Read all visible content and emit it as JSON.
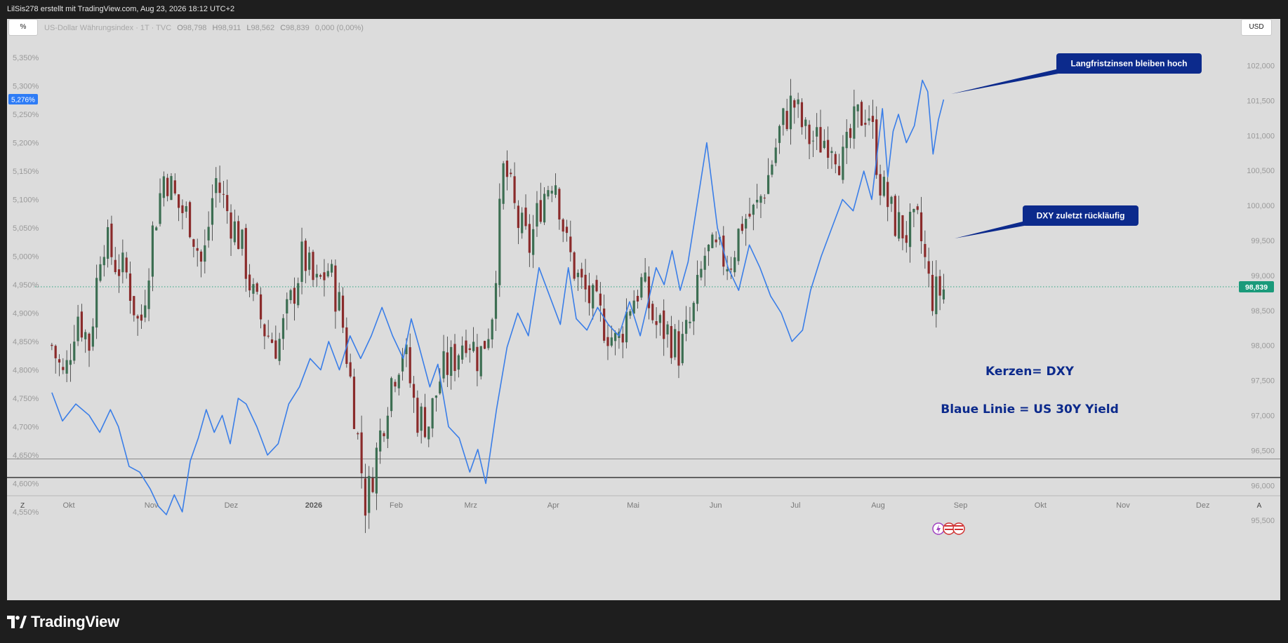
{
  "header": {
    "text": "LilSis278 erstellt mit TradingView.com, Aug 23, 2026 18:12 UTC+2"
  },
  "toolbar": {
    "scale_left": "%",
    "currency": "USD",
    "zoom_label": "Z",
    "auto_label": "A"
  },
  "legend": {
    "name": "US-Dollar Währungsindex · 1T · TVC",
    "open_prefix": "O",
    "open": "98,798",
    "high_prefix": "H",
    "high": "98,911",
    "low_prefix": "L",
    "low": "98,562",
    "close_prefix": "C",
    "close": "98,839",
    "change": "0,000 (0,00%)"
  },
  "price_badges": {
    "yield_last": "5,276%",
    "dxy_last": "98,839"
  },
  "annotations": {
    "top_label": "Langfristzinsen bleiben hoch",
    "mid_label": "DXY zuletzt rückläufig",
    "legend_line1": "Kerzen= DXY",
    "legend_line2": "Blaue Linie = US 30Y Yield"
  },
  "brand": {
    "name": "TradingView"
  },
  "colors": {
    "up": "#3c6e52",
    "down": "#8a2b2b",
    "yield_line": "#3a7ee8",
    "annotation_bg": "#0c2a8c",
    "annotation_text": "#0c2a8c",
    "badge_yield": "#2e7cf6",
    "badge_dxy": "#1a9a7a"
  },
  "chart_data": {
    "type": "line",
    "x_axis": {
      "labels": [
        "Okt",
        "Nov",
        "Dez",
        "2026",
        "Feb",
        "Mrz",
        "Apr",
        "Mai",
        "Jun",
        "Jul",
        "Aug",
        "Sep",
        "Okt",
        "Nov",
        "Dez"
      ]
    },
    "y_axis_left": {
      "labels": [
        "5,350%",
        "5,300%",
        "5,250%",
        "5,200%",
        "5,150%",
        "5,100%",
        "5,050%",
        "5,000%",
        "4,950%",
        "4,900%",
        "4,850%",
        "4,800%",
        "4,750%",
        "4,700%",
        "4,650%",
        "4,600%",
        "4,550%"
      ],
      "range": [
        4.5,
        5.38
      ]
    },
    "y_axis_right": {
      "labels": [
        "102,000",
        "101,500",
        "101,000",
        "100,500",
        "100,000",
        "99,500",
        "99,000",
        "98,500",
        "98,000",
        "97,500",
        "97,000",
        "96,500",
        "96,000",
        "95,500"
      ],
      "range": [
        95.0,
        102.4
      ]
    },
    "series": [
      {
        "axis": "left",
        "last": 5.276,
        "points": [
          [
            "2025-09-22",
            4.76
          ],
          [
            "2025-09-26",
            4.71
          ],
          [
            "2025-10-01",
            4.74
          ],
          [
            "2025-10-06",
            4.72
          ],
          [
            "2025-10-10",
            4.69
          ],
          [
            "2025-10-14",
            4.73
          ],
          [
            "2025-10-17",
            4.7
          ],
          [
            "2025-10-21",
            4.63
          ],
          [
            "2025-10-25",
            4.62
          ],
          [
            "2025-10-29",
            4.59
          ],
          [
            "2025-11-01",
            4.56
          ],
          [
            "2025-11-04",
            4.545
          ],
          [
            "2025-11-07",
            4.58
          ],
          [
            "2025-11-10",
            4.55
          ],
          [
            "2025-11-13",
            4.64
          ],
          [
            "2025-11-16",
            4.68
          ],
          [
            "2025-11-19",
            4.73
          ],
          [
            "2025-11-22",
            4.69
          ],
          [
            "2025-11-25",
            4.72
          ],
          [
            "2025-11-28",
            4.67
          ],
          [
            "2025-12-01",
            4.75
          ],
          [
            "2025-12-04",
            4.74
          ],
          [
            "2025-12-08",
            4.7
          ],
          [
            "2025-12-12",
            4.65
          ],
          [
            "2025-12-16",
            4.67
          ],
          [
            "2025-12-20",
            4.74
          ],
          [
            "2025-12-24",
            4.77
          ],
          [
            "2025-12-28",
            4.82
          ],
          [
            "2026-01-01",
            4.8
          ],
          [
            "2026-01-04",
            4.85
          ],
          [
            "2026-01-08",
            4.8
          ],
          [
            "2026-01-12",
            4.86
          ],
          [
            "2026-01-16",
            4.82
          ],
          [
            "2026-01-20",
            4.86
          ],
          [
            "2026-01-24",
            4.91
          ],
          [
            "2026-01-28",
            4.86
          ],
          [
            "2026-02-01",
            4.82
          ],
          [
            "2026-02-04",
            4.89
          ],
          [
            "2026-02-07",
            4.84
          ],
          [
            "2026-02-11",
            4.77
          ],
          [
            "2026-02-14",
            4.81
          ],
          [
            "2026-02-18",
            4.7
          ],
          [
            "2026-02-22",
            4.68
          ],
          [
            "2026-02-26",
            4.62
          ],
          [
            "2026-03-01",
            4.66
          ],
          [
            "2026-03-04",
            4.6
          ],
          [
            "2026-03-08",
            4.73
          ],
          [
            "2026-03-12",
            4.84
          ],
          [
            "2026-03-16",
            4.9
          ],
          [
            "2026-03-20",
            4.86
          ],
          [
            "2026-03-24",
            4.98
          ],
          [
            "2026-03-28",
            4.93
          ],
          [
            "2026-04-01",
            4.88
          ],
          [
            "2026-04-04",
            4.98
          ],
          [
            "2026-04-07",
            4.89
          ],
          [
            "2026-04-11",
            4.87
          ],
          [
            "2026-04-15",
            4.91
          ],
          [
            "2026-04-19",
            4.88
          ],
          [
            "2026-04-23",
            4.86
          ],
          [
            "2026-04-27",
            4.92
          ],
          [
            "2026-05-01",
            4.86
          ],
          [
            "2026-05-04",
            4.92
          ],
          [
            "2026-05-07",
            4.98
          ],
          [
            "2026-05-10",
            4.95
          ],
          [
            "2026-05-13",
            5.01
          ],
          [
            "2026-05-16",
            4.94
          ],
          [
            "2026-05-19",
            4.99
          ],
          [
            "2026-05-22",
            5.08
          ],
          [
            "2026-05-26",
            5.2
          ],
          [
            "2026-05-30",
            5.05
          ],
          [
            "2026-06-03",
            4.98
          ],
          [
            "2026-06-07",
            4.94
          ],
          [
            "2026-06-11",
            5.02
          ],
          [
            "2026-06-15",
            4.98
          ],
          [
            "2026-06-19",
            4.93
          ],
          [
            "2026-06-23",
            4.9
          ],
          [
            "2026-06-27",
            4.85
          ],
          [
            "2026-07-01",
            4.87
          ],
          [
            "2026-07-04",
            4.94
          ],
          [
            "2026-07-08",
            5.0
          ],
          [
            "2026-07-12",
            5.05
          ],
          [
            "2026-07-16",
            5.1
          ],
          [
            "2026-07-20",
            5.08
          ],
          [
            "2026-07-24",
            5.15
          ],
          [
            "2026-07-27",
            5.1
          ],
          [
            "2026-07-29",
            5.18
          ],
          [
            "2026-07-31",
            5.26
          ],
          [
            "2026-08-02",
            5.14
          ],
          [
            "2026-08-04",
            5.22
          ],
          [
            "2026-08-06",
            5.25
          ],
          [
            "2026-08-09",
            5.2
          ],
          [
            "2026-08-12",
            5.23
          ],
          [
            "2026-08-15",
            5.31
          ],
          [
            "2026-08-17",
            5.29
          ],
          [
            "2026-08-19",
            5.18
          ],
          [
            "2026-08-21",
            5.24
          ],
          [
            "2026-08-23",
            5.276
          ]
        ]
      },
      {
        "axis": "right",
        "type": "candlestick",
        "last": 98.839,
        "start": "2025-09-22",
        "end": "2026-08-23",
        "close_path": [
          98.0,
          97.5,
          98.5,
          98.0,
          99.6,
          99.2,
          99.0,
          98.2,
          99.6,
          100.5,
          100.0,
          99.8,
          99.1,
          100.4,
          99.9,
          99.5,
          98.7,
          98.2,
          98.0,
          98.6,
          99.3,
          98.8,
          99.1,
          98.5,
          97.2,
          95.7,
          96.6,
          97.5,
          98.0,
          97.0,
          96.9,
          97.6,
          97.8,
          98.2,
          97.8,
          98.4,
          100.6,
          99.8,
          99.4,
          100.1,
          100.5,
          99.4,
          98.9,
          98.6,
          98.3,
          98.0,
          98.6,
          98.9,
          98.3,
          98.2,
          97.9,
          98.4,
          99.3,
          99.3,
          99.2,
          99.8,
          99.9,
          100.4,
          101.1,
          101.5,
          101.0,
          100.9,
          101.0,
          100.6,
          101.2,
          101.4,
          100.3,
          99.8,
          99.6,
          99.7,
          98.7,
          98.8
        ]
      }
    ],
    "last_date": "2026-08-23"
  }
}
